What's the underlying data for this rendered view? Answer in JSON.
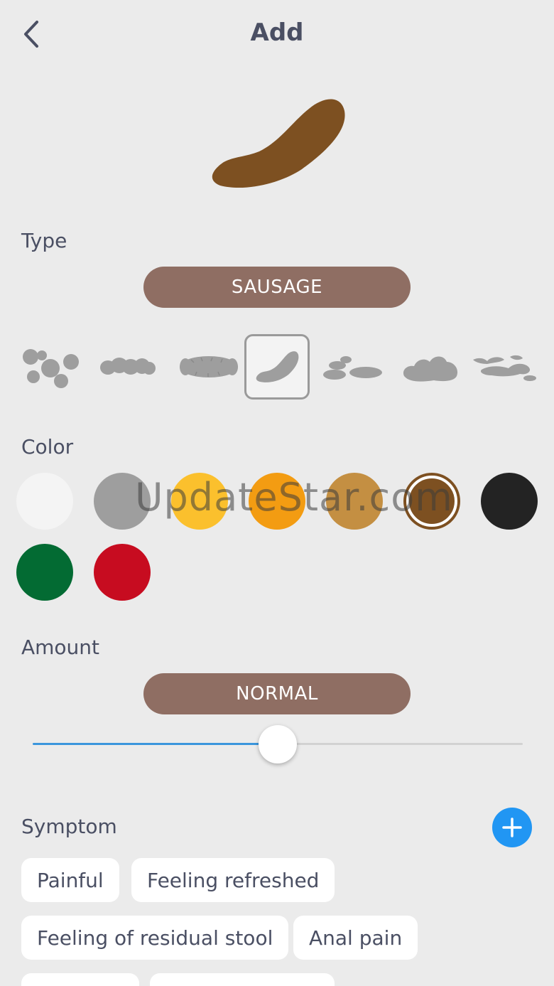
{
  "header": {
    "title": "Add",
    "back_icon": "chevron-left-icon"
  },
  "hero": {
    "icon": "sausage-stool-icon",
    "color": "#7d5021"
  },
  "type": {
    "label": "Type",
    "selected_label": "SAUSAGE",
    "options": [
      {
        "name": "separate-lumps-icon"
      },
      {
        "name": "lumpy-sausage-icon"
      },
      {
        "name": "cracked-sausage-icon"
      },
      {
        "name": "smooth-sausage-icon",
        "selected": true
      },
      {
        "name": "soft-blobs-icon"
      },
      {
        "name": "mushy-icon"
      },
      {
        "name": "watery-icon"
      }
    ]
  },
  "color": {
    "label": "Color",
    "swatches": [
      {
        "name": "white",
        "hex": "#f4f4f4"
      },
      {
        "name": "gray",
        "hex": "#9e9e9e"
      },
      {
        "name": "yellow",
        "hex": "#fbc02d"
      },
      {
        "name": "orange",
        "hex": "#f39c12"
      },
      {
        "name": "tan",
        "hex": "#c48f42"
      },
      {
        "name": "brown",
        "hex": "#7d5021",
        "selected": true
      },
      {
        "name": "black",
        "hex": "#232323"
      },
      {
        "name": "green",
        "hex": "#036b33"
      },
      {
        "name": "red",
        "hex": "#c70c20"
      }
    ]
  },
  "watermark": "UpdateStar.com",
  "amount": {
    "label": "Amount",
    "selected_label": "NORMAL",
    "slider_fraction": 0.5
  },
  "symptom": {
    "label": "Symptom",
    "add_icon": "plus-icon",
    "chips": [
      "Painful",
      "Feeling refreshed",
      "Feeling of residual stool",
      "Anal pain"
    ]
  },
  "colors": {
    "accent": "#2196f3",
    "pill": "#8f6e63",
    "background": "#ebebeb",
    "text": "#4a4f63"
  }
}
